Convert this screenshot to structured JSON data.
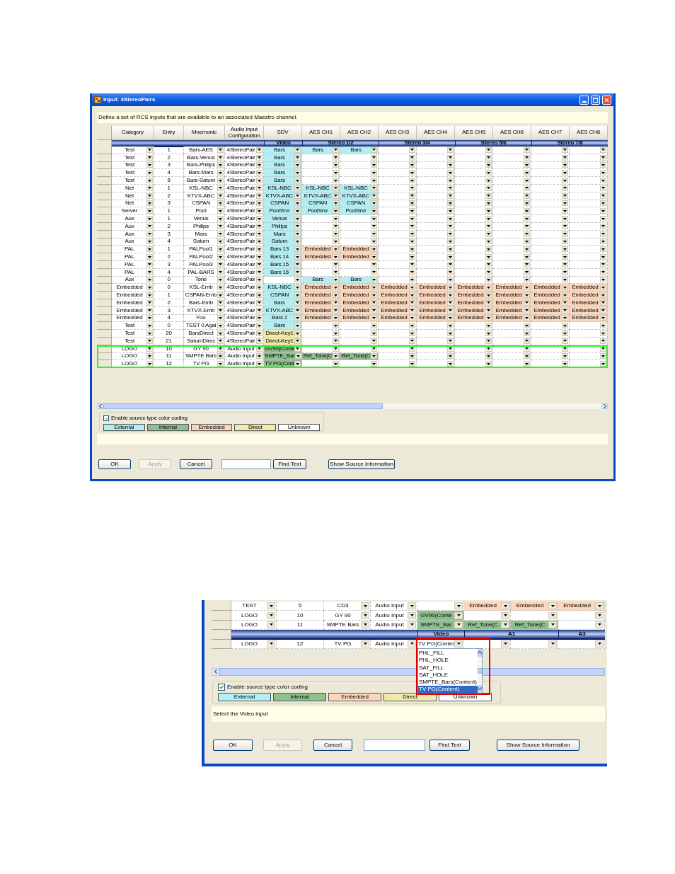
{
  "windows": [
    {
      "title": "Input: 4StereoPairs",
      "instruction": "Define a set of RCS inputs that are available to an associated Maestro channel.",
      "columns": [
        "Category",
        "Entry",
        "Mnemonic",
        "Audio Input Configuration",
        "SDV",
        "AES CH1",
        "AES CH2",
        "AES CH3",
        "AES CH4",
        "AES CH5",
        "AES CH6",
        "AES CH7",
        "AES CH8"
      ],
      "rows": [
        {
          "kind": "band",
          "groups": [
            {
              "label": "Video"
            },
            {
              "label": "Stereo 1/2"
            },
            {
              "label": "Stereo 3/4"
            },
            {
              "label": "Stereo 5/6"
            },
            {
              "label": "Stereo 7/8"
            }
          ]
        },
        {
          "kind": "data",
          "selected": false,
          "category": "Test",
          "entry": "1",
          "mnemonic": "Bars-AES",
          "audio": "4StereoPair",
          "sources": [
            {
              "text": "Bars",
              "color": "#b4eef2"
            },
            {
              "text": "Bars",
              "color": "#b4eef2"
            },
            {
              "text": "Bars",
              "color": "#b4eef2"
            },
            {
              "color": "#ffffff"
            },
            {
              "color": "#ffffff"
            },
            {
              "color": "#ffffff"
            },
            {
              "color": "#ffffff"
            },
            {
              "color": "#ffffff"
            },
            {
              "color": "#ffffff"
            }
          ]
        },
        {
          "kind": "data",
          "selected": false,
          "category": "Test",
          "entry": "2",
          "mnemonic": "Bars-Venus",
          "audio": "4StereoPair",
          "sources": [
            {
              "text": "Bars",
              "color": "#b4eef2"
            },
            {
              "color": "#ffffff"
            },
            {
              "color": "#ffffff"
            },
            {
              "color": "#ffffff"
            },
            {
              "color": "#ffffff"
            },
            {
              "color": "#ffffff"
            },
            {
              "color": "#ffffff"
            },
            {
              "color": "#ffffff"
            },
            {
              "color": "#ffffff"
            }
          ]
        },
        {
          "kind": "data",
          "selected": false,
          "category": "Test",
          "entry": "3",
          "mnemonic": "Bars-Philips",
          "audio": "4StereoPair",
          "sources": [
            {
              "text": "Bars",
              "color": "#b4eef2"
            },
            {
              "color": "#ffffff"
            },
            {
              "color": "#ffffff"
            },
            {
              "color": "#ffffff"
            },
            {
              "color": "#ffffff"
            },
            {
              "color": "#ffffff"
            },
            {
              "color": "#ffffff"
            },
            {
              "color": "#ffffff"
            },
            {
              "color": "#ffffff"
            }
          ]
        },
        {
          "kind": "data",
          "selected": false,
          "category": "Test",
          "entry": "4",
          "mnemonic": "Bars-Mars",
          "audio": "4StereoPair",
          "sources": [
            {
              "text": "Bars",
              "color": "#b4eef2"
            },
            {
              "color": "#ffffff"
            },
            {
              "color": "#ffffff"
            },
            {
              "color": "#ffffff"
            },
            {
              "color": "#ffffff"
            },
            {
              "color": "#ffffff"
            },
            {
              "color": "#ffffff"
            },
            {
              "color": "#ffffff"
            },
            {
              "color": "#ffffff"
            }
          ]
        },
        {
          "kind": "data",
          "selected": false,
          "category": "Test",
          "entry": "5",
          "mnemonic": "Bars-Saturn",
          "audio": "4StereoPair",
          "sources": [
            {
              "text": "Bars",
              "color": "#b4eef2"
            },
            {
              "color": "#ffffff"
            },
            {
              "color": "#ffffff"
            },
            {
              "color": "#ffffff"
            },
            {
              "color": "#ffffff"
            },
            {
              "color": "#ffffff"
            },
            {
              "color": "#ffffff"
            },
            {
              "color": "#ffffff"
            },
            {
              "color": "#ffffff"
            }
          ]
        },
        {
          "kind": "data",
          "selected": false,
          "category": "Net",
          "entry": "1",
          "mnemonic": "KSL-NBC",
          "audio": "4StereoPair",
          "sources": [
            {
              "text": "KSL-NBC",
              "color": "#b4eef2"
            },
            {
              "text": "KSL-NBC",
              "color": "#b4eef2"
            },
            {
              "text": "KSL-NBC",
              "color": "#b4eef2"
            },
            {
              "color": "#ffffff"
            },
            {
              "color": "#ffffff"
            },
            {
              "color": "#ffffff"
            },
            {
              "color": "#ffffff"
            },
            {
              "color": "#ffffff"
            },
            {
              "color": "#ffffff"
            }
          ]
        },
        {
          "kind": "data",
          "selected": false,
          "category": "Net",
          "entry": "2",
          "mnemonic": "KTVX-ABC",
          "audio": "4StereoPair",
          "sources": [
            {
              "text": "KTVX-ABC",
              "color": "#b4eef2"
            },
            {
              "text": "KTVX-ABC",
              "color": "#b4eef2"
            },
            {
              "text": "KTVX-ABC",
              "color": "#b4eef2"
            },
            {
              "color": "#ffffff"
            },
            {
              "color": "#ffffff"
            },
            {
              "color": "#ffffff"
            },
            {
              "color": "#ffffff"
            },
            {
              "color": "#ffffff"
            },
            {
              "color": "#ffffff"
            }
          ]
        },
        {
          "kind": "data",
          "selected": false,
          "category": "Net",
          "entry": "3",
          "mnemonic": "CSPAN",
          "audio": "4StereoPair",
          "sources": [
            {
              "text": "CSPAN",
              "color": "#b4eef2"
            },
            {
              "text": "CSPAN",
              "color": "#b4eef2"
            },
            {
              "text": "CSPAN",
              "color": "#b4eef2"
            },
            {
              "color": "#ffffff"
            },
            {
              "color": "#ffffff"
            },
            {
              "color": "#ffffff"
            },
            {
              "color": "#ffffff"
            },
            {
              "color": "#ffffff"
            },
            {
              "color": "#ffffff"
            }
          ]
        },
        {
          "kind": "data",
          "selected": false,
          "category": "Server",
          "entry": "1",
          "mnemonic": "Pool",
          "audio": "4StereoPair",
          "sources": [
            {
              "text": "PoolSrvr",
              "color": "#b4eef2"
            },
            {
              "text": "PoolSrvr",
              "color": "#b4eef2"
            },
            {
              "text": "PoolSrvr",
              "color": "#b4eef2"
            },
            {
              "color": "#ffffff"
            },
            {
              "color": "#ffffff"
            },
            {
              "color": "#ffffff"
            },
            {
              "color": "#ffffff"
            },
            {
              "color": "#ffffff"
            },
            {
              "color": "#ffffff"
            }
          ]
        },
        {
          "kind": "data",
          "selected": false,
          "category": "Aux",
          "entry": "1",
          "mnemonic": "Venus",
          "audio": "4StereoPair",
          "sources": [
            {
              "text": "Venus",
              "color": "#b4eef2"
            },
            {
              "color": "#ffffff"
            },
            {
              "color": "#ffffff"
            },
            {
              "color": "#ffffff"
            },
            {
              "color": "#ffffff"
            },
            {
              "color": "#ffffff"
            },
            {
              "color": "#ffffff"
            },
            {
              "color": "#ffffff"
            },
            {
              "color": "#ffffff"
            }
          ]
        },
        {
          "kind": "data",
          "selected": false,
          "category": "Aux",
          "entry": "2",
          "mnemonic": "Philips",
          "audio": "4StereoPair",
          "sources": [
            {
              "text": "Philips",
              "color": "#b4eef2"
            },
            {
              "color": "#ffffff"
            },
            {
              "color": "#ffffff"
            },
            {
              "color": "#ffffff"
            },
            {
              "color": "#ffffff"
            },
            {
              "color": "#ffffff"
            },
            {
              "color": "#ffffff"
            },
            {
              "color": "#ffffff"
            },
            {
              "color": "#ffffff"
            }
          ]
        },
        {
          "kind": "data",
          "selected": false,
          "category": "Aux",
          "entry": "3",
          "mnemonic": "Mars",
          "audio": "4StereoPair",
          "sources": [
            {
              "text": "Mars",
              "color": "#b4eef2"
            },
            {
              "color": "#ffffff"
            },
            {
              "color": "#ffffff"
            },
            {
              "color": "#ffffff"
            },
            {
              "color": "#ffffff"
            },
            {
              "color": "#ffffff"
            },
            {
              "color": "#ffffff"
            },
            {
              "color": "#ffffff"
            },
            {
              "color": "#ffffff"
            }
          ]
        },
        {
          "kind": "data",
          "selected": false,
          "category": "Aux",
          "entry": "4",
          "mnemonic": "Saturn",
          "audio": "4StereoPair",
          "sources": [
            {
              "text": "Saturn",
              "color": "#b4eef2"
            },
            {
              "color": "#ffffff"
            },
            {
              "color": "#ffffff"
            },
            {
              "color": "#ffffff"
            },
            {
              "color": "#ffffff"
            },
            {
              "color": "#ffffff"
            },
            {
              "color": "#ffffff"
            },
            {
              "color": "#ffffff"
            },
            {
              "color": "#ffffff"
            }
          ]
        },
        {
          "kind": "data",
          "selected": false,
          "category": "PAL",
          "entry": "1",
          "mnemonic": "PALPool1",
          "audio": "4StereoPair",
          "sources": [
            {
              "text": "Bars 13",
              "color": "#b4eef2"
            },
            {
              "text": "Embedded",
              "color": "#fbd6bb"
            },
            {
              "text": "Embedded",
              "color": "#fbd6bb"
            },
            {
              "color": "#ffffff"
            },
            {
              "color": "#ffffff"
            },
            {
              "color": "#ffffff"
            },
            {
              "color": "#ffffff"
            },
            {
              "color": "#ffffff"
            },
            {
              "color": "#ffffff"
            }
          ]
        },
        {
          "kind": "data",
          "selected": false,
          "category": "PAL",
          "entry": "2",
          "mnemonic": "PALPool2",
          "audio": "4StereoPair",
          "sources": [
            {
              "text": "Bars 14",
              "color": "#b4eef2"
            },
            {
              "text": "Embedded",
              "color": "#fbd6bb"
            },
            {
              "text": "Embedded",
              "color": "#fbd6bb"
            },
            {
              "color": "#ffffff"
            },
            {
              "color": "#ffffff"
            },
            {
              "color": "#ffffff"
            },
            {
              "color": "#ffffff"
            },
            {
              "color": "#ffffff"
            },
            {
              "color": "#ffffff"
            }
          ]
        },
        {
          "kind": "data",
          "selected": false,
          "category": "PAL",
          "entry": "3",
          "mnemonic": "PALPool3",
          "audio": "4StereoPair",
          "sources": [
            {
              "text": "Bars 15",
              "color": "#b4eef2"
            },
            {
              "color": "#ffffff"
            },
            {
              "color": "#ffffff"
            },
            {
              "color": "#ffffff"
            },
            {
              "color": "#ffffff"
            },
            {
              "color": "#ffffff"
            },
            {
              "color": "#ffffff"
            },
            {
              "color": "#ffffff"
            },
            {
              "color": "#ffffff"
            }
          ]
        },
        {
          "kind": "data",
          "selected": false,
          "category": "PAL",
          "entry": "4",
          "mnemonic": "PAL-BARS",
          "audio": "4StereoPair",
          "sources": [
            {
              "text": "Bars 16",
              "color": "#b4eef2"
            },
            {
              "color": "#ffffff"
            },
            {
              "color": "#ffffff"
            },
            {
              "color": "#ffffff"
            },
            {
              "color": "#ffffff"
            },
            {
              "color": "#ffffff"
            },
            {
              "color": "#ffffff"
            },
            {
              "color": "#ffffff"
            },
            {
              "color": "#ffffff"
            }
          ]
        },
        {
          "kind": "data",
          "selected": false,
          "category": "Aux",
          "entry": "0",
          "mnemonic": "Tone",
          "audio": "4StereoPair",
          "sources": [
            {
              "color": "#ffffff"
            },
            {
              "text": "Bars",
              "color": "#b4eef2"
            },
            {
              "text": "Bars",
              "color": "#b4eef2"
            },
            {
              "color": "#ffffff"
            },
            {
              "color": "#ffffff"
            },
            {
              "color": "#ffffff"
            },
            {
              "color": "#ffffff"
            },
            {
              "color": "#ffffff"
            },
            {
              "color": "#ffffff"
            }
          ]
        },
        {
          "kind": "data",
          "selected": false,
          "category": "Embedded",
          "entry": "0",
          "mnemonic": "KSL-Emb",
          "audio": "4StereoPair",
          "sources": [
            {
              "text": "KSL-NBC",
              "color": "#b4eef2"
            },
            {
              "text": "Embedded",
              "color": "#fbd6bb"
            },
            {
              "text": "Embedded",
              "color": "#fbd6bb"
            },
            {
              "text": "Embedded",
              "color": "#fbd6bb"
            },
            {
              "text": "Embedded",
              "color": "#fbd6bb"
            },
            {
              "text": "Embedded",
              "color": "#fbd6bb"
            },
            {
              "text": "Embedded",
              "color": "#fbd6bb"
            },
            {
              "text": "Embedded",
              "color": "#fbd6bb"
            },
            {
              "text": "Embedded",
              "color": "#fbd6bb"
            }
          ]
        },
        {
          "kind": "data",
          "selected": false,
          "category": "Embedded",
          "entry": "1",
          "mnemonic": "CSPAN-Emb",
          "audio": "4StereoPair",
          "sources": [
            {
              "text": "CSPAN",
              "color": "#b4eef2"
            },
            {
              "text": "Embedded",
              "color": "#fbd6bb"
            },
            {
              "text": "Embedded",
              "color": "#fbd6bb"
            },
            {
              "text": "Embedded",
              "color": "#fbd6bb"
            },
            {
              "text": "Embedded",
              "color": "#fbd6bb"
            },
            {
              "text": "Embedded",
              "color": "#fbd6bb"
            },
            {
              "text": "Embedded",
              "color": "#fbd6bb"
            },
            {
              "text": "Embedded",
              "color": "#fbd6bb"
            },
            {
              "text": "Embedded",
              "color": "#fbd6bb"
            }
          ]
        },
        {
          "kind": "data",
          "selected": false,
          "category": "Embedded",
          "entry": "2",
          "mnemonic": "Bars-Emb",
          "audio": "4StereoPair",
          "sources": [
            {
              "text": "Bars",
              "color": "#b4eef2"
            },
            {
              "text": "Embedded",
              "color": "#fbd6bb"
            },
            {
              "text": "Embedded",
              "color": "#fbd6bb"
            },
            {
              "text": "Embedded",
              "color": "#fbd6bb"
            },
            {
              "text": "Embedded",
              "color": "#fbd6bb"
            },
            {
              "text": "Embedded",
              "color": "#fbd6bb"
            },
            {
              "text": "Embedded",
              "color": "#fbd6bb"
            },
            {
              "text": "Embedded",
              "color": "#fbd6bb"
            },
            {
              "text": "Embedded",
              "color": "#fbd6bb"
            }
          ]
        },
        {
          "kind": "data",
          "selected": false,
          "category": "Embedded",
          "entry": "3",
          "mnemonic": "KTVX-Emb",
          "audio": "4StereoPair",
          "sources": [
            {
              "text": "KTVX-ABC",
              "color": "#b4eef2"
            },
            {
              "text": "Embedded",
              "color": "#fbd6bb"
            },
            {
              "text": "Embedded",
              "color": "#fbd6bb"
            },
            {
              "text": "Embedded",
              "color": "#fbd6bb"
            },
            {
              "text": "Embedded",
              "color": "#fbd6bb"
            },
            {
              "text": "Embedded",
              "color": "#fbd6bb"
            },
            {
              "text": "Embedded",
              "color": "#fbd6bb"
            },
            {
              "text": "Embedded",
              "color": "#fbd6bb"
            },
            {
              "text": "Embedded",
              "color": "#fbd6bb"
            }
          ]
        },
        {
          "kind": "data",
          "selected": false,
          "category": "Embedded",
          "entry": "4",
          "mnemonic": "Foo",
          "audio": "4StereoPair",
          "sources": [
            {
              "text": "Bars 2",
              "color": "#b4eef2"
            },
            {
              "text": "Embedded",
              "color": "#fbd6bb"
            },
            {
              "text": "Embedded",
              "color": "#fbd6bb"
            },
            {
              "text": "Embedded",
              "color": "#fbd6bb"
            },
            {
              "text": "Embedded",
              "color": "#fbd6bb"
            },
            {
              "text": "Embedded",
              "color": "#fbd6bb"
            },
            {
              "text": "Embedded",
              "color": "#fbd6bb"
            },
            {
              "text": "Embedded",
              "color": "#fbd6bb"
            },
            {
              "text": "Embedded",
              "color": "#fbd6bb"
            }
          ]
        },
        {
          "kind": "data",
          "selected": false,
          "category": "Test",
          "entry": "0",
          "mnemonic": "TEST 0 Agai",
          "audio": "4StereoPair",
          "sources": [
            {
              "text": "Bars",
              "color": "#b4eef2"
            },
            {
              "color": "#ffffff"
            },
            {
              "color": "#ffffff"
            },
            {
              "color": "#ffffff"
            },
            {
              "color": "#ffffff"
            },
            {
              "color": "#ffffff"
            },
            {
              "color": "#ffffff"
            },
            {
              "color": "#ffffff"
            },
            {
              "color": "#ffffff"
            }
          ]
        },
        {
          "kind": "data",
          "selected": false,
          "category": "Test",
          "entry": "20",
          "mnemonic": "BarsDirect",
          "audio": "4StereoPair",
          "sources": [
            {
              "text": "Direct-Key1",
              "color": "#f2eaaa"
            },
            {
              "color": "#ffffff"
            },
            {
              "color": "#ffffff"
            },
            {
              "color": "#ffffff"
            },
            {
              "color": "#ffffff"
            },
            {
              "color": "#ffffff"
            },
            {
              "color": "#ffffff"
            },
            {
              "color": "#ffffff"
            },
            {
              "color": "#ffffff"
            }
          ]
        },
        {
          "kind": "data",
          "selected": false,
          "category": "Test",
          "entry": "21",
          "mnemonic": "SaturnDirec",
          "audio": "4StereoPair",
          "sources": [
            {
              "text": "Direct-Key1",
              "color": "#f2eaaa"
            },
            {
              "color": "#ffffff"
            },
            {
              "color": "#ffffff"
            },
            {
              "color": "#ffffff"
            },
            {
              "color": "#ffffff"
            },
            {
              "color": "#ffffff"
            },
            {
              "color": "#ffffff"
            },
            {
              "color": "#ffffff"
            },
            {
              "color": "#ffffff"
            }
          ]
        },
        {
          "kind": "data",
          "selected": true,
          "category": "LOGO",
          "entry": "10",
          "mnemonic": "GY 90",
          "audio": "Audio Input",
          "sources": [
            {
              "text": "GV90(Conte",
              "color": "#8fbf8f"
            },
            {
              "color": "#ffffff"
            },
            {
              "color": "#ffffff"
            },
            {
              "color": "#ffffff"
            },
            {
              "color": "#ffffff"
            },
            {
              "color": "#ffffff"
            },
            {
              "color": "#ffffff"
            },
            {
              "color": "#ffffff"
            },
            {
              "color": "#ffffff"
            }
          ]
        },
        {
          "kind": "data",
          "selected": true,
          "category": "LOGO",
          "entry": "11",
          "mnemonic": "SMPTE Bars",
          "audio": "Audio Input",
          "sources": [
            {
              "text": "SMPTE_Bar",
              "color": "#8fbf8f"
            },
            {
              "text": "Ref_Tone(C",
              "color": "#8fbf8f"
            },
            {
              "text": "Ref_Tone(C",
              "color": "#8fbf8f"
            },
            {
              "color": "#ffffff"
            },
            {
              "color": "#ffffff"
            },
            {
              "color": "#ffffff"
            },
            {
              "color": "#ffffff"
            },
            {
              "color": "#ffffff"
            },
            {
              "color": "#ffffff"
            }
          ]
        },
        {
          "kind": "data",
          "selected": true,
          "category": "LOGO",
          "entry": "12",
          "mnemonic": "TV PG",
          "audio": "Audio Input",
          "sources": [
            {
              "text": "TV PG(Cont",
              "color": "#8fbf8f"
            },
            {
              "color": "#ffffff"
            },
            {
              "color": "#ffffff"
            },
            {
              "color": "#ffffff"
            },
            {
              "color": "#ffffff"
            },
            {
              "color": "#ffffff"
            },
            {
              "color": "#ffffff"
            },
            {
              "color": "#ffffff"
            },
            {
              "color": "#ffffff"
            }
          ]
        }
      ],
      "color_coding": {
        "label": "Enable source type color coding",
        "checked": true,
        "legend": [
          {
            "label": "External",
            "color": "#b4eef2"
          },
          {
            "label": "Internal",
            "color": "#8fbf8f"
          },
          {
            "label": "Embedded",
            "color": "#fbd6bb"
          },
          {
            "label": "Direct",
            "color": "#f2eaaa"
          },
          {
            "label": "Unknown",
            "color": "#ffffff"
          }
        ]
      },
      "buttons": [
        {
          "kind": "button",
          "label": "OK",
          "disabled": false
        },
        {
          "kind": "button",
          "label": "Apply",
          "disabled": true
        },
        {
          "kind": "button",
          "label": "Cancel",
          "disabled": false
        },
        {
          "kind": "field"
        },
        {
          "kind": "button",
          "label": "Find Text",
          "disabled": false
        },
        {
          "kind": "button",
          "label": "Show Source Information",
          "disabled": false
        }
      ]
    },
    {
      "rows": [
        {
          "kind": "data",
          "selected": false,
          "category": "TEST",
          "entry": "5",
          "mnemonic": "CD3",
          "audio": "Audio Input",
          "sources": [
            {
              "color": "#ffffff"
            },
            {
              "text": "Embedded",
              "color": "#fbd6bb"
            },
            {
              "text": "Embedded",
              "color": "#fbd6bb"
            },
            {
              "text": "Embedded",
              "color": "#fbd6bb"
            }
          ]
        },
        {
          "kind": "data",
          "selected": false,
          "category": "LOGO",
          "entry": "10",
          "mnemonic": "GY 90",
          "audio": "Audio Input",
          "sources": [
            {
              "text": "GV90(Conte",
              "color": "#8fbf8f"
            },
            {
              "color": "#ffffff"
            },
            {
              "color": "#ffffff"
            },
            {
              "color": "#ffffff"
            }
          ]
        },
        {
          "kind": "data",
          "selected": false,
          "category": "LOGO",
          "entry": "11",
          "mnemonic": "SMPTE Bars",
          "audio": "Audio Input",
          "sources": [
            {
              "text": "SMPTE_Bar",
              "color": "#8fbf8f"
            },
            {
              "text": "Ref_Tone(C",
              "color": "#8fbf8f"
            },
            {
              "text": "Ref_Tone(C",
              "color": "#8fbf8f"
            },
            {
              "color": "#ffffff"
            }
          ]
        },
        {
          "kind": "band",
          "groups": [
            {
              "label": "Video"
            },
            {
              "label": "A1"
            },
            {
              "label": "A3"
            }
          ]
        },
        {
          "kind": "data",
          "selected": false,
          "category": "LOGO",
          "entry": "12",
          "mnemonic": "TV PG",
          "audio": "Audio Input",
          "sources": [
            {
              "text": "TV PG(Conter",
              "color": "#ffffff",
              "dropdown": [
                {
                  "label": "PHL_FILL",
                  "selected": false
                },
                {
                  "label": "PHL_HOLE",
                  "selected": false
                },
                {
                  "label": "SAT_FILL",
                  "selected": false
                },
                {
                  "label": "SAT_HOLE",
                  "selected": false
                },
                {
                  "label": "SMPTE_Bars(Content)",
                  "selected": false
                },
                {
                  "label": "TV PG(Content)",
                  "selected": true
                }
              ]
            },
            {
              "color": "#ffffff"
            },
            {
              "color": "#ffffff"
            },
            {
              "color": "#ffffff"
            }
          ]
        }
      ],
      "color_coding": {
        "label": "Enable source type color coding",
        "checked": true,
        "legend": [
          {
            "label": "External",
            "color": "#b4eef2"
          },
          {
            "label": "Internal",
            "color": "#8fbf8f"
          },
          {
            "label": "Embedded",
            "color": "#fbd6bb"
          },
          {
            "label": "Direct",
            "color": "#f2eaaa"
          },
          {
            "label": "Unknown",
            "color": "#ffffff"
          }
        ]
      },
      "status": "Select the Video input",
      "buttons": [
        {
          "kind": "button",
          "label": "OK",
          "disabled": false
        },
        {
          "kind": "button",
          "label": "Apply",
          "disabled": true
        },
        {
          "kind": "button",
          "label": "Cancel",
          "disabled": false
        },
        {
          "kind": "field"
        },
        {
          "kind": "button",
          "label": "Find Text",
          "disabled": false
        },
        {
          "kind": "button",
          "label": "Show Source Information",
          "disabled": false
        }
      ]
    }
  ]
}
